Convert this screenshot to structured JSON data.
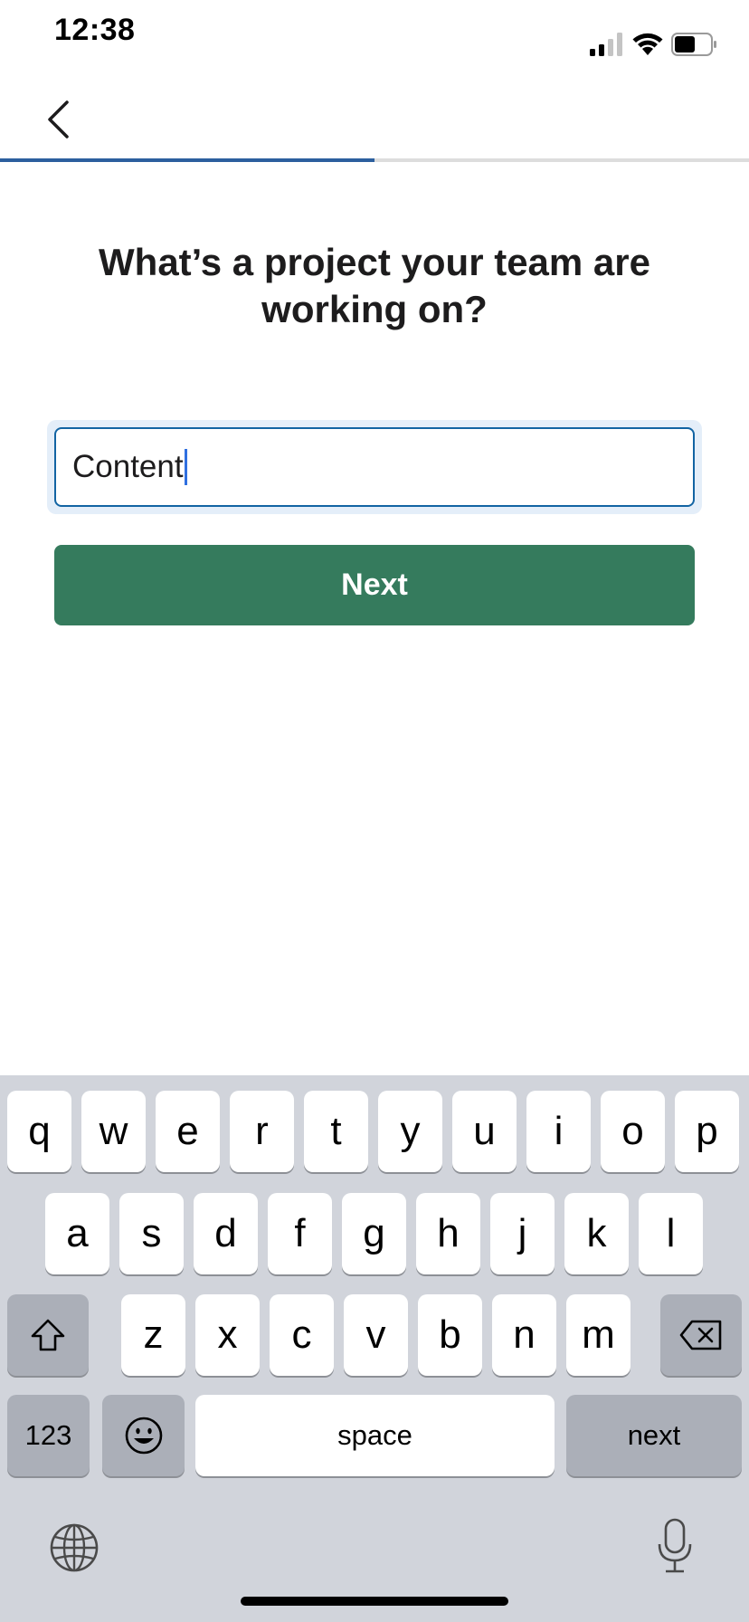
{
  "status_bar": {
    "time": "12:38",
    "icons": [
      "signal-icon",
      "wifi-icon",
      "battery-icon"
    ]
  },
  "nav": {
    "back_icon": "chevron-left-icon",
    "progress": 0.5
  },
  "main": {
    "title": "What’s a project your team are working on?",
    "input_value": "Content",
    "next_label": "Next"
  },
  "keyboard": {
    "row1": [
      "q",
      "w",
      "e",
      "r",
      "t",
      "y",
      "u",
      "i",
      "o",
      "p"
    ],
    "row2": [
      "a",
      "s",
      "d",
      "f",
      "g",
      "h",
      "j",
      "k",
      "l"
    ],
    "row3": [
      "z",
      "x",
      "c",
      "v",
      "b",
      "n",
      "m"
    ],
    "shift_icon": "shift-icon",
    "delete_icon": "delete-icon",
    "numbers_label": "123",
    "emoji_icon": "emoji-icon",
    "space_label": "space",
    "return_label": "next",
    "globe_icon": "globe-icon",
    "mic_icon": "microphone-icon"
  },
  "colors": {
    "progress": "#2c5f9e",
    "input_border": "#1264a3",
    "button": "#357b5d",
    "keyboard_bg": "#d1d4db"
  }
}
